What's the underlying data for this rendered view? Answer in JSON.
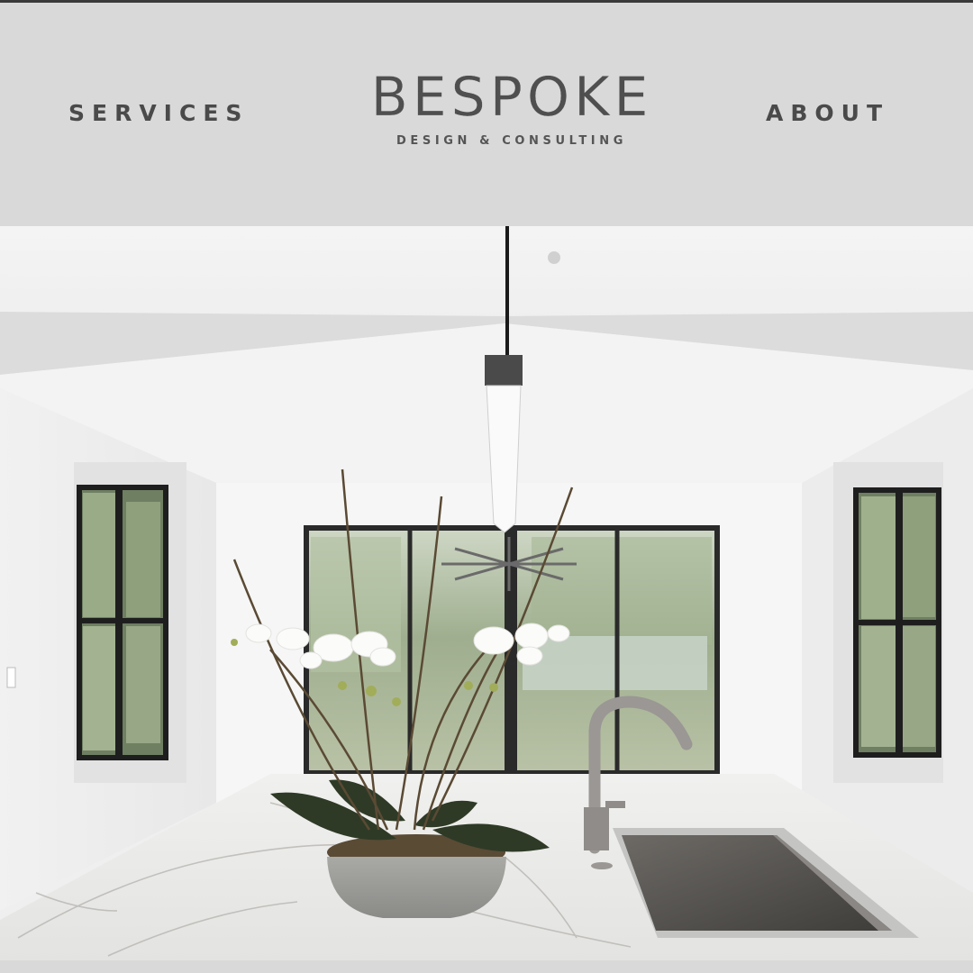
{
  "header": {
    "nav_left": "SERVICES",
    "nav_right": "ABOUT",
    "logo": {
      "name": "BESPOKE",
      "tagline": "DESIGN & CONSULTING"
    }
  },
  "colors": {
    "header_background": "#d9d9d9",
    "nav_text": "#4a4a4a",
    "logo_text": "#4f4f4f"
  },
  "hero": {
    "icon": "kitchen-interior-photo"
  }
}
